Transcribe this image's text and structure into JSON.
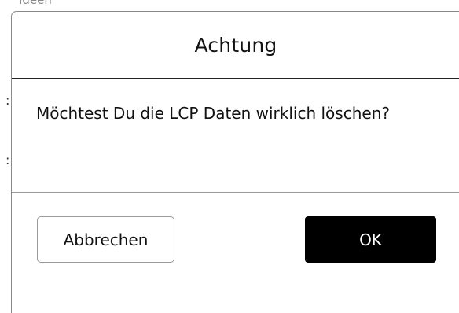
{
  "background": {
    "fragment_text": "Ideen"
  },
  "dialog": {
    "title": "Achtung",
    "message": "Möchtest Du die LCP Daten wirklich löschen?",
    "cancel_label": "Abbrechen",
    "confirm_label": "OK"
  },
  "colors": {
    "confirm_button_bg": "#000000",
    "confirm_button_text": "#ffffff",
    "dialog_bg": "#ffffff"
  }
}
